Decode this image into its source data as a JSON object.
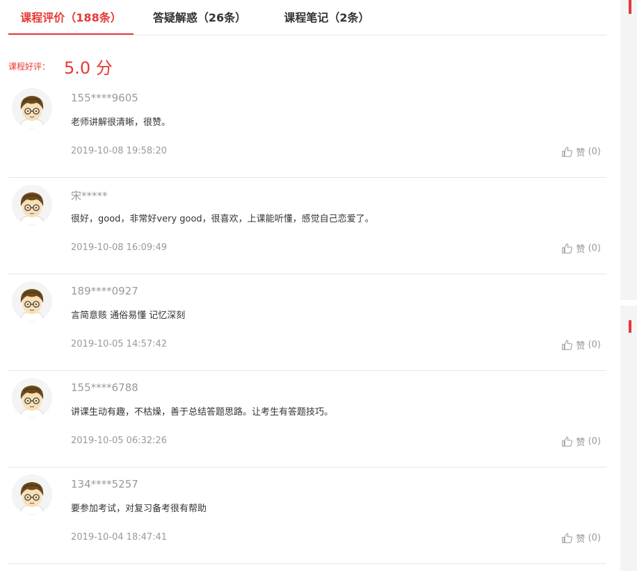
{
  "tabs": [
    {
      "label": "课程评价（188条）",
      "active": true
    },
    {
      "label": "答疑解惑（26条）",
      "active": false
    },
    {
      "label": "课程笔记（2条）",
      "active": false
    }
  ],
  "rating": {
    "label": "课程好评：",
    "value": "5.0 分"
  },
  "reviews": [
    {
      "user": "155****9605",
      "content": "老师讲解很清晰，很赞。",
      "time": "2019-10-08 19:58:20",
      "like_label": "赞",
      "like_count": "(0)"
    },
    {
      "user": "宋*****",
      "content": "很好，good，非常好very good，很喜欢，上课能听懂，感觉自己恋爱了。",
      "time": "2019-10-08 16:09:49",
      "like_label": "赞",
      "like_count": "(0)"
    },
    {
      "user": "189****0927",
      "content": "言简意赅 通俗易懂 记忆深刻",
      "time": "2019-10-05 14:57:42",
      "like_label": "赞",
      "like_count": "(0)"
    },
    {
      "user": "155****6788",
      "content": "讲课生动有趣，不枯燥，善于总结答题思路。让考生有答题技巧。",
      "time": "2019-10-05 06:32:26",
      "like_label": "赞",
      "like_count": "(0)"
    },
    {
      "user": "134****5257",
      "content": "要参加考试，对复习备考很有帮助",
      "time": "2019-10-04 18:47:41",
      "like_label": "赞",
      "like_count": "(0)"
    }
  ],
  "icons": {
    "avatar": "cartoon-boy-avatar",
    "like": "thumbs-up-icon"
  },
  "colors": {
    "accent": "#e53935",
    "muted": "#999999",
    "text": "#333333"
  }
}
